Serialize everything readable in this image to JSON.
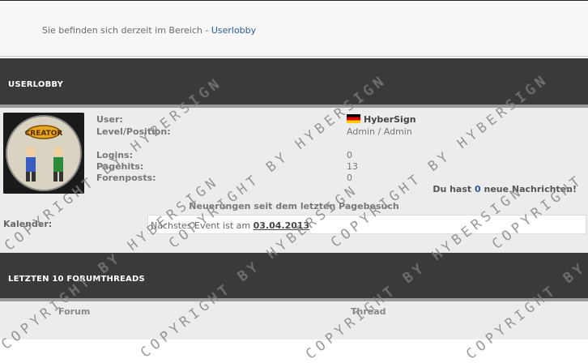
{
  "breadcrumb": {
    "prefix": "Sie befinden sich derzeit im Bereich - ",
    "link": "Userlobby"
  },
  "lobby": {
    "title": "USERLOBBY",
    "labels": {
      "user": "User:",
      "level": "Level/Position:",
      "logins": "Logins:",
      "pagehits": "Pagehits:",
      "posts": "Forenposts:"
    },
    "values": {
      "user": "HyberSign",
      "level": "Admin / Admin",
      "logins": "0",
      "pagehits": "13",
      "posts": "0"
    },
    "messages": {
      "before": "Du hast ",
      "count": "0",
      "after": " neue Nachrichten!"
    },
    "changes": "Neuerungen seit dem letzten Pagebesuch",
    "calendar": {
      "label": "Kalender:",
      "text": "Nächstes Event ist am ",
      "date": "03.04.2013"
    }
  },
  "threads": {
    "title": "LETZTEN 10 FORUMTHREADS",
    "col_forum": "Forum",
    "col_thread": "Thread"
  },
  "watermark": "COPYRIGHT BY HYBERSIGN",
  "avatar": {
    "caption": "CREATOR"
  },
  "colors": {
    "header": "#3a3a3a",
    "link": "#2a5a9a",
    "panel": "#ececec"
  }
}
